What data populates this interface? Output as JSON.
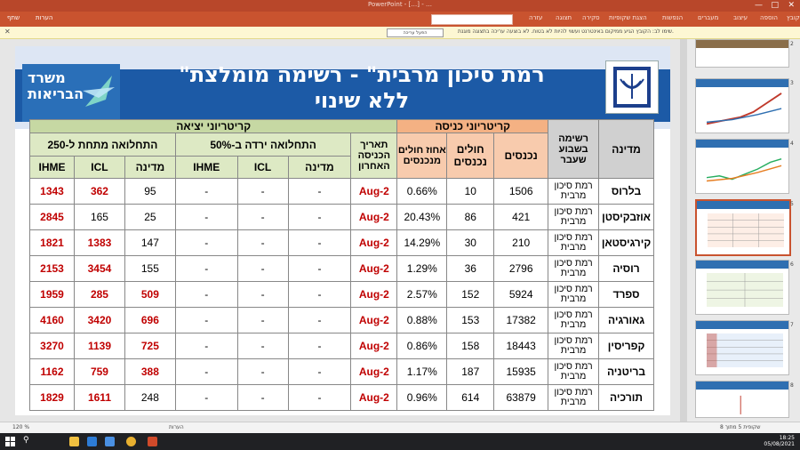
{
  "window": {
    "title": "PowerPoint - […] - …",
    "buttons": {
      "close": "✕",
      "max": "□",
      "min": "—"
    }
  },
  "ribbon": {
    "tabs": [
      "קובץ",
      "בית",
      "הוספה",
      "עיצוב",
      "מעברים",
      "הנפשות",
      "הצגת שקופיות",
      "סקירה",
      "תצוגה",
      "עזרה"
    ],
    "share": "שתף",
    "comments": "הערות"
  },
  "message_bar": {
    "text": "שימו לב: הקובץ הגיע ממיקום באינטרנט ועשוי להיות לא בטוח. לא בוצעה עריכה בתצוגה מוגנת.",
    "button": "הפעל עריכה",
    "close": "✕"
  },
  "slide": {
    "logo_lines": [
      "משרד",
      "הבריאות"
    ],
    "title_line1": "\"רמת סיכון מרבית\" - רשימה מומלצת",
    "title_line2": "ללא שינוי",
    "table": {
      "h_country": "מדינה",
      "h_list": "רשימה בשבוע שעבר",
      "h_entry": "קריטריוני כניסה",
      "h_entrants": "נכנסים",
      "h_sick": "חולים נכנסים",
      "h_pct": "אחוז חולים מנכנסים",
      "h_date": "תאריך הכניסה האחרון",
      "h_exit": "קריטריוני יציאה",
      "h_decline": "התחלואה ירדה ב-50%",
      "h_below": "התחלואה מתחת ל-250",
      "h_state": "מדינה",
      "h_icl": "ICL",
      "h_ihme": "IHME",
      "rows": [
        {
          "country": "בלרוס",
          "list": "רמת סיכון מרבית",
          "entrants": "1506",
          "sick": "10",
          "pct": "0.66%",
          "date": "2-Aug",
          "d_state": "-",
          "d_icl": "-",
          "d_ihme": "-",
          "b_state": "95",
          "b_icl": "362",
          "b_ihme": "1343",
          "red_state": false,
          "red_icl": true
        },
        {
          "country": "אוזבקיסטן",
          "list": "רמת סיכון מרבית",
          "entrants": "421",
          "sick": "86",
          "pct": "20.43%",
          "date": "2-Aug",
          "d_state": "-",
          "d_icl": "-",
          "d_ihme": "-",
          "b_state": "25",
          "b_icl": "165",
          "b_ihme": "2845",
          "red_state": false,
          "red_icl": false
        },
        {
          "country": "קירגיסטאן",
          "list": "רמת סיכון מרבית",
          "entrants": "210",
          "sick": "30",
          "pct": "14.29%",
          "date": "2-Aug",
          "d_state": "-",
          "d_icl": "-",
          "d_ihme": "-",
          "b_state": "147",
          "b_icl": "1383",
          "b_ihme": "1821",
          "red_state": false,
          "red_icl": true
        },
        {
          "country": "רוסיה",
          "list": "רמת סיכון מרבית",
          "entrants": "2796",
          "sick": "36",
          "pct": "1.29%",
          "date": "2-Aug",
          "d_state": "-",
          "d_icl": "-",
          "d_ihme": "-",
          "b_state": "155",
          "b_icl": "3454",
          "b_ihme": "2153",
          "red_state": false,
          "red_icl": true
        },
        {
          "country": "ספרד",
          "list": "רמת סיכון מרבית",
          "entrants": "5924",
          "sick": "152",
          "pct": "2.57%",
          "date": "2-Aug",
          "d_state": "-",
          "d_icl": "-",
          "d_ihme": "-",
          "b_state": "509",
          "b_icl": "285",
          "b_ihme": "1959",
          "red_state": true,
          "red_icl": true
        },
        {
          "country": "גאורגיה",
          "list": "רמת סיכון מרבית",
          "entrants": "17382",
          "sick": "153",
          "pct": "0.88%",
          "date": "2-Aug",
          "d_state": "-",
          "d_icl": "-",
          "d_ihme": "-",
          "b_state": "696",
          "b_icl": "3420",
          "b_ihme": "4160",
          "red_state": true,
          "red_icl": true
        },
        {
          "country": "קפריסין",
          "list": "רמת סיכון מרבית",
          "entrants": "18443",
          "sick": "158",
          "pct": "0.86%",
          "date": "2-Aug",
          "d_state": "-",
          "d_icl": "-",
          "d_ihme": "-",
          "b_state": "725",
          "b_icl": "1139",
          "b_ihme": "3270",
          "red_state": true,
          "red_icl": true
        },
        {
          "country": "בריטניה",
          "list": "רמת סיכון מרבית",
          "entrants": "15935",
          "sick": "187",
          "pct": "1.17%",
          "date": "2-Aug",
          "d_state": "-",
          "d_icl": "-",
          "d_ihme": "-",
          "b_state": "388",
          "b_icl": "759",
          "b_ihme": "1162",
          "red_state": true,
          "red_icl": true
        },
        {
          "country": "תורכיה",
          "list": "רמת סיכון מרבית",
          "entrants": "63879",
          "sick": "614",
          "pct": "0.96%",
          "date": "2-Aug",
          "d_state": "-",
          "d_icl": "-",
          "d_ihme": "-",
          "b_state": "248",
          "b_icl": "1611",
          "b_ihme": "1829",
          "red_state": false,
          "red_icl": true
        }
      ]
    }
  },
  "thumbnails": {
    "numbers": [
      "2",
      "3",
      "4",
      "5",
      "6",
      "7",
      "8"
    ],
    "selected": "5"
  },
  "status": {
    "zoom": "120 %",
    "slide_of": "שקופית 5 מתוך 8",
    "notes": "הערות"
  },
  "taskbar": {
    "time": "18:25",
    "date": "05/08/2021"
  },
  "colors": {
    "accent": "#c9532f",
    "slide_blue": "#1c5aa6",
    "red_value": "#c00000",
    "entry_header": "#f4b183",
    "exit_header": "#c6d8a3"
  }
}
